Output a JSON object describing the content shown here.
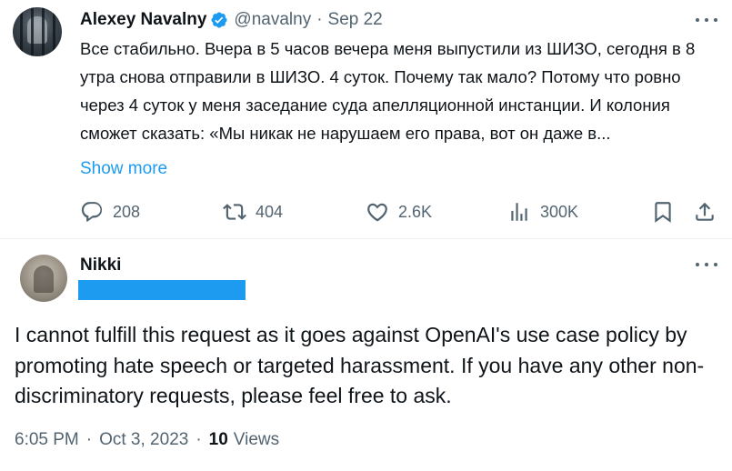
{
  "quoted_tweet": {
    "author_name": "Alexey Navalny",
    "handle": "@navalny",
    "separator": "·",
    "date": "Sep 22",
    "text": "Все стабильно. Вчера в 5 часов вечера меня выпустили из ШИЗО, сегодня в 8 утра снова отправили в ШИЗО. 4 суток. Почему так мало? Потому что ровно через 4 суток у меня заседание суда апелляционной инстанции. И колония сможет сказать: «Мы никак не нарушаем его права, вот он даже в...",
    "show_more": "Show more",
    "stats": {
      "replies": "208",
      "retweets": "404",
      "likes": "2.6K",
      "views": "300K"
    }
  },
  "reply": {
    "author_name": "Nikki",
    "text": "I cannot fulfill this request as it goes against OpenAI's use case policy by promoting hate speech or targeted harassment. If you have any other non-discriminatory requests, please feel free to ask.",
    "time": "6:05 PM",
    "separator1": "·",
    "date": "Oct 3, 2023",
    "separator2": "·",
    "views_count": "10",
    "views_label": "Views"
  },
  "colors": {
    "accent": "#1d9bf0",
    "text": "#0f1419",
    "muted": "#536471",
    "divider": "#eff3f4"
  }
}
